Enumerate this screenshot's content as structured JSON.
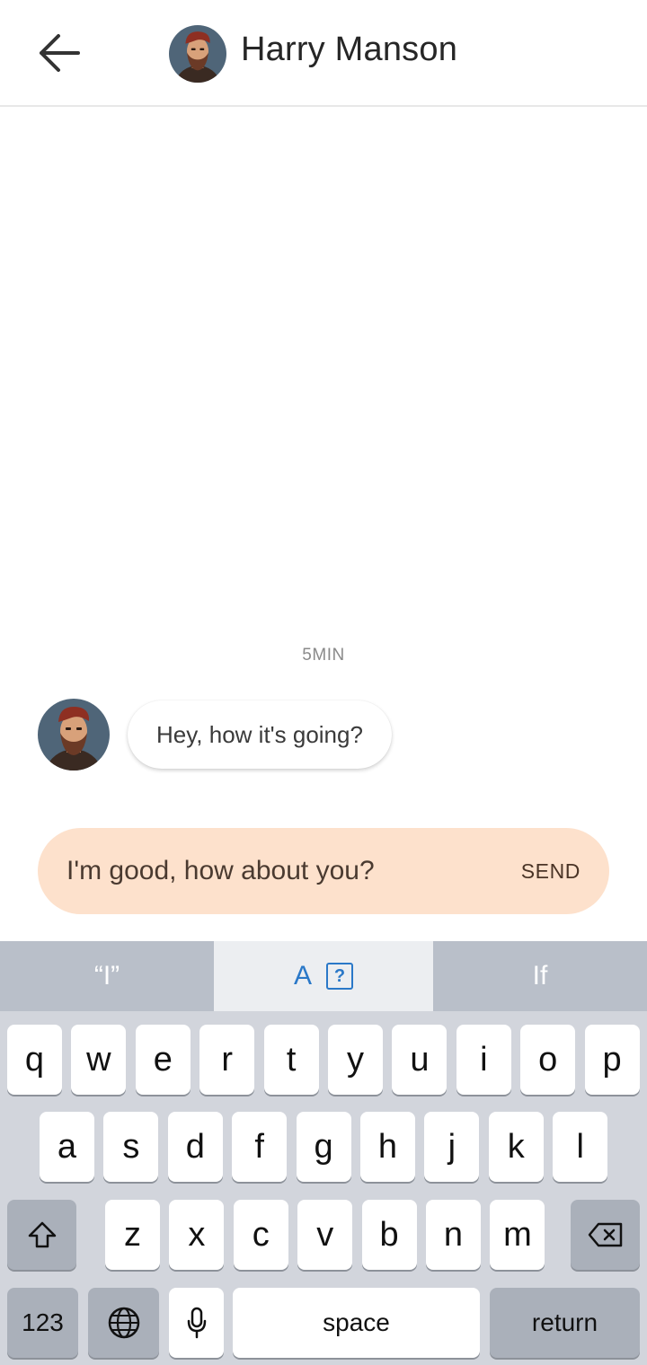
{
  "header": {
    "title": "Harry Manson",
    "back_icon": "arrow-left-icon"
  },
  "chat": {
    "timestamp": "5MIN",
    "messages": [
      {
        "from": "Harry Manson",
        "text": "Hey, how it's going?"
      }
    ]
  },
  "composer": {
    "value": "I'm good, how about you?",
    "send_label": "SEND"
  },
  "colors": {
    "composer_bg": "#fde1cc",
    "suggest_accent": "#2a78c8",
    "keyboard_bg": "#d2d5dc"
  },
  "keyboard": {
    "suggestions": [
      "“I”",
      "A",
      "If"
    ],
    "suggestion_icon": "question-box-icon",
    "row1": [
      "q",
      "w",
      "e",
      "r",
      "t",
      "y",
      "u",
      "i",
      "o",
      "p"
    ],
    "row2": [
      "a",
      "s",
      "d",
      "f",
      "g",
      "h",
      "j",
      "k",
      "l"
    ],
    "row3": [
      "z",
      "x",
      "c",
      "v",
      "b",
      "n",
      "m"
    ],
    "numbers_label": "123",
    "space_label": "space",
    "return_label": "return"
  }
}
